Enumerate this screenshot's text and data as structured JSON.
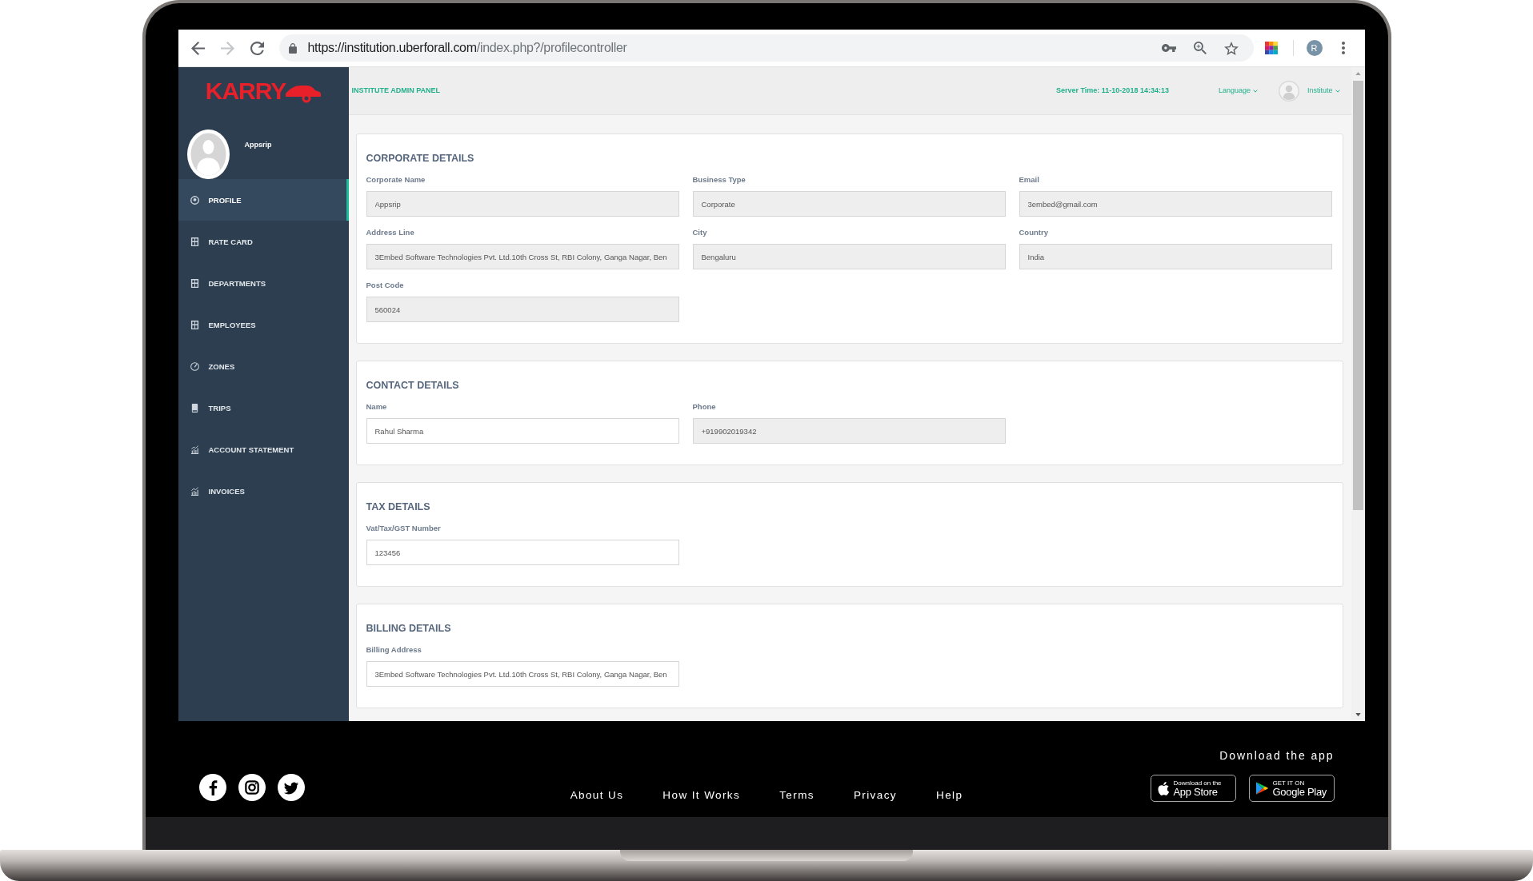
{
  "browser": {
    "nav": [
      {
        "disabled": false
      },
      {
        "disabled": true
      },
      {
        "disabled": false
      }
    ],
    "url_origin": "https://institution.uberforall.com",
    "url_path": "/index.php?/profilecontroller",
    "profile_initial": "R"
  },
  "sidebar": {
    "logo": "KARRY",
    "user_name": "Appsrip",
    "items": [
      {
        "label": "PROFILE",
        "selected": true
      },
      {
        "label": "RATE CARD",
        "selected": false
      },
      {
        "label": "DEPARTMENTS",
        "selected": false
      },
      {
        "label": "EMPLOYEES",
        "selected": false
      },
      {
        "label": "ZONES",
        "selected": false
      },
      {
        "label": "TRIPS",
        "selected": false
      },
      {
        "label": "ACCOUNT STATEMENT",
        "selected": false
      },
      {
        "label": "INVOICES",
        "selected": false
      }
    ]
  },
  "header": {
    "panel_title": "INSTITUTE ADMIN PANEL",
    "server_time": "Server Time: 11-10-2018 14:34:13",
    "language_menu": "Language",
    "user_menu": "Institute"
  },
  "sections": [
    {
      "title": "CORPORATE DETAILS",
      "fields": [
        {
          "label": "Corporate Name",
          "value": "Appsrip",
          "disabled": true
        },
        {
          "label": "Business Type",
          "value": "Corporate",
          "disabled": true
        },
        {
          "label": "Email",
          "value": "3embed@gmail.com",
          "disabled": true
        },
        {
          "label": "Address Line",
          "value": "3Embed Software Technologies Pvt. Ltd.10th Cross St, RBI Colony, Ganga Nagar, Ben",
          "disabled": true
        },
        {
          "label": "City",
          "value": "Bengaluru",
          "disabled": true
        },
        {
          "label": "Country",
          "value": "India",
          "disabled": true
        },
        {
          "label": "Post Code",
          "value": "560024",
          "disabled": true
        }
      ]
    },
    {
      "title": "CONTACT DETAILS",
      "fields": [
        {
          "label": "Name",
          "value": "Rahul Sharma",
          "disabled": false
        },
        {
          "label": "Phone",
          "value": "+919902019342",
          "disabled": true
        }
      ]
    },
    {
      "title": "TAX DETAILS",
      "fields": [
        {
          "label": "Vat/Tax/GST Number",
          "value": "123456",
          "disabled": false
        }
      ]
    },
    {
      "title": "BILLING DETAILS",
      "fields": [
        {
          "label": "Billing Address",
          "value": "3Embed Software Technologies Pvt. Ltd.10th Cross St, RBI Colony, Ganga Nagar, Ben",
          "disabled": false
        }
      ]
    }
  ],
  "footer": {
    "links": [
      "About Us",
      "How It Works",
      "Terms",
      "Privacy",
      "Help"
    ],
    "download_heading": "Download the app",
    "store_badges": [
      {
        "caption": "Download on the",
        "name": "App Store"
      },
      {
        "caption": "GET IT ON",
        "name": "Google Play"
      }
    ]
  }
}
